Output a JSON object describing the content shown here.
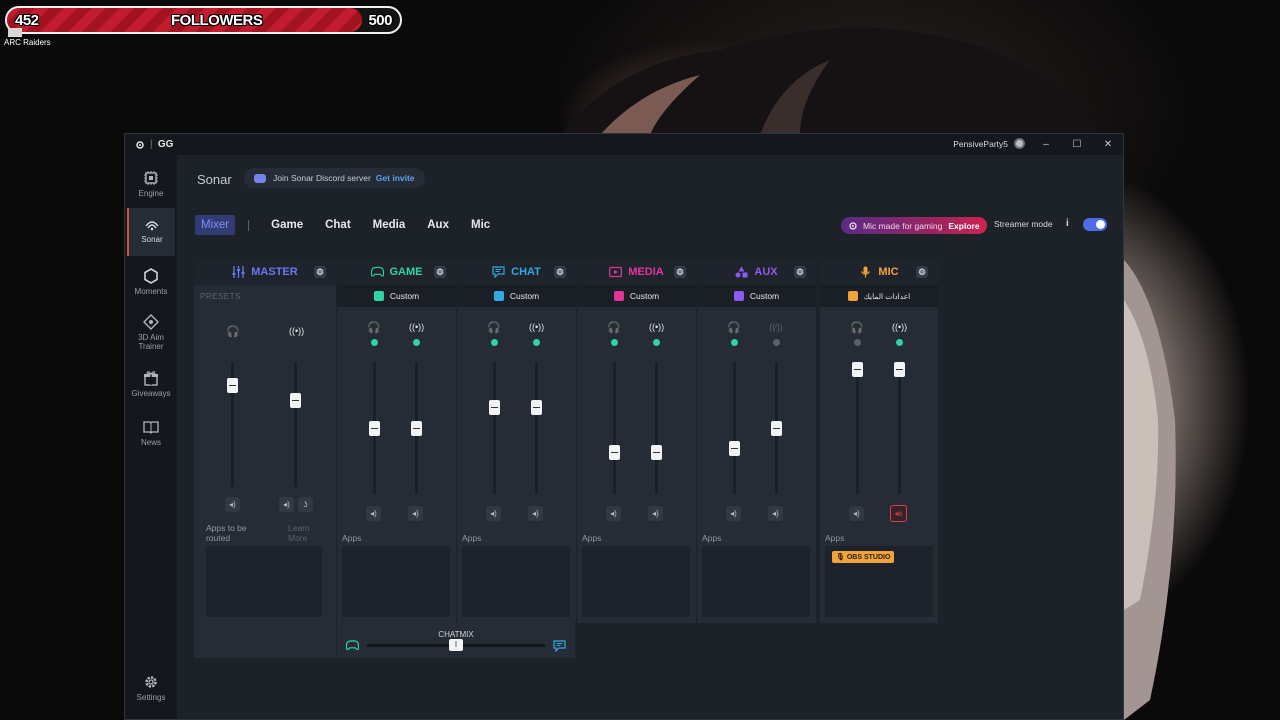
{
  "overlay": {
    "followers_current": "452",
    "followers_label": "FOLLOWERS",
    "followers_goal": "500",
    "followers_progress": 0.904
  },
  "desktop": {
    "icon_label": "ARC Raiders"
  },
  "titlebar": {
    "app_name": "GG",
    "username": "PensiveParty5",
    "min": "–",
    "max": "☐",
    "close": "✕"
  },
  "sidebar": {
    "items": [
      {
        "label": "Engine",
        "icon": "chip-icon"
      },
      {
        "label": "Sonar",
        "icon": "sonar-icon"
      },
      {
        "label": "Moments",
        "icon": "hexagon-icon"
      },
      {
        "label": "3D Aim Trainer",
        "icon": "crosshair-icon"
      },
      {
        "label": "Giveaways",
        "icon": "gift-icon"
      },
      {
        "label": "News",
        "icon": "book-icon"
      },
      {
        "label": "Settings",
        "icon": "gear-icon"
      }
    ]
  },
  "header": {
    "title": "Sonar",
    "discord_text": "Join Sonar Discord server",
    "discord_link": "Get invite"
  },
  "tabs": [
    "Mixer",
    "Game",
    "Chat",
    "Media",
    "Aux",
    "Mic"
  ],
  "promo": {
    "text": "Mic made for gaming",
    "link": "Explore"
  },
  "streamer": {
    "label": "Streamer mode",
    "info": "i",
    "enabled": true
  },
  "colors": {
    "master": "#6878f0",
    "game": "#2fd3a4",
    "chat": "#34a8e0",
    "media": "#e0349a",
    "aux": "#8d5af0",
    "mic": "#f0a33b",
    "dot_on": "#2fd3a4",
    "dot_off": "#5c626b"
  },
  "channels": {
    "master": {
      "name": "MASTER",
      "presets": "PRESETS",
      "apps_hint": "Apps to be routed",
      "learn": "Learn More",
      "monitor_level": 0.82,
      "stream_level": 0.7
    },
    "game": {
      "name": "GAME",
      "preset": "Custom",
      "apps": "Apps",
      "monitor_level": 0.5,
      "stream_level": 0.5
    },
    "chat": {
      "name": "CHAT",
      "preset": "Custom",
      "apps": "Apps",
      "monitor_level": 0.66,
      "stream_level": 0.66
    },
    "media": {
      "name": "MEDIA",
      "preset": "Custom",
      "apps": "Apps",
      "monitor_level": 0.32,
      "stream_level": 0.32
    },
    "aux": {
      "name": "AUX",
      "preset": "Custom",
      "apps": "Apps",
      "monitor_level": 0.35,
      "stream_level": 0.5
    },
    "mic": {
      "name": "MIC",
      "preset": "اعدادات المايك",
      "apps": "Apps",
      "app_chip": "OBS STUDIO",
      "monitor_level": 0.95,
      "stream_level": 0.95
    }
  },
  "chatmix": {
    "label": "CHATMIX",
    "balance": 0.5,
    "thumb_glyph": "I"
  }
}
